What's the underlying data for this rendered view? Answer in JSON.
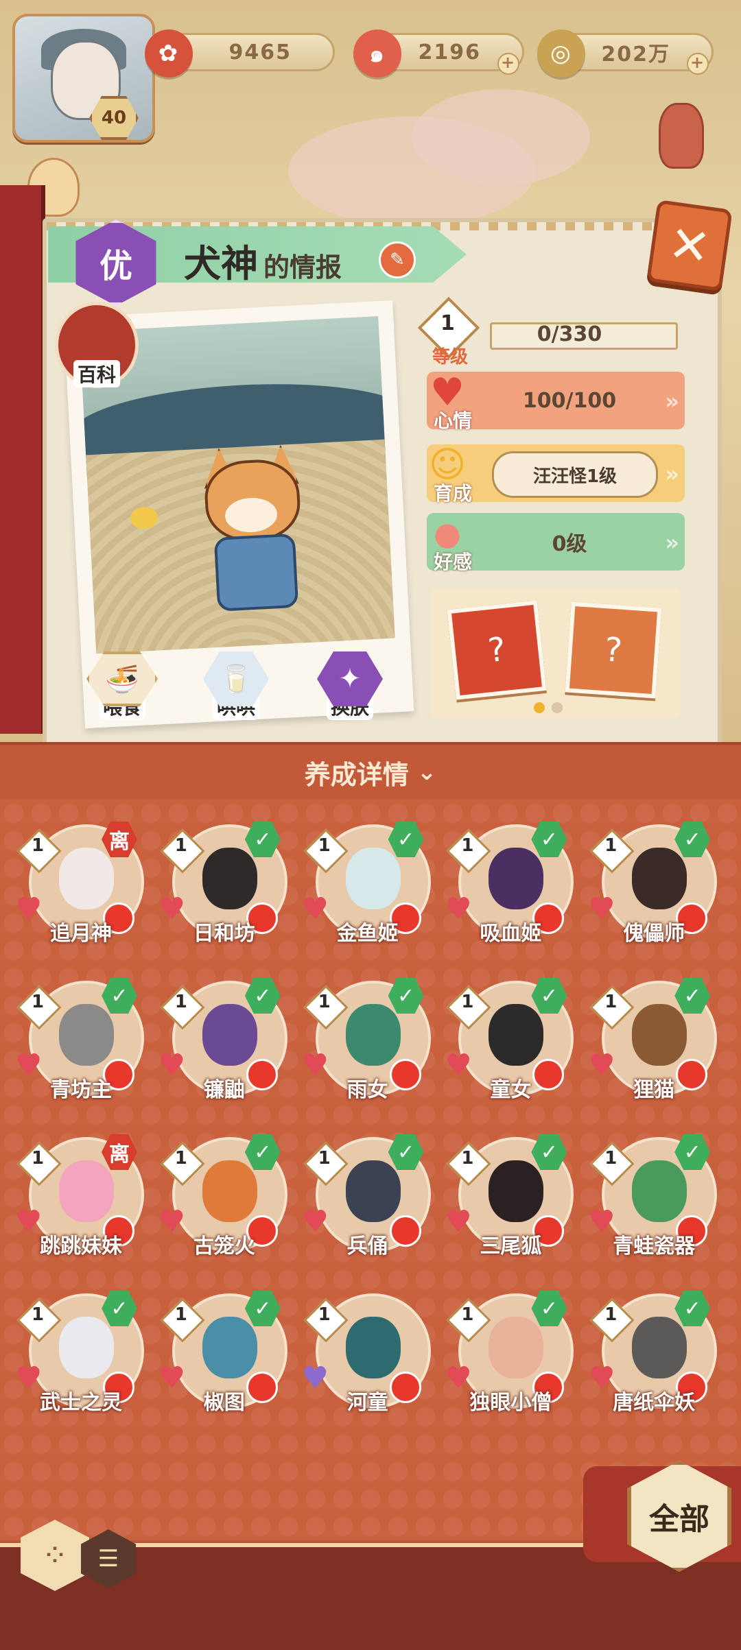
{
  "player": {
    "level": "40"
  },
  "currencies": [
    {
      "icon": "plum-flower-icon",
      "value": "9465",
      "color": "#d6533b"
    },
    {
      "icon": "magatama-icon",
      "value": "2196",
      "color": "#e0604a"
    },
    {
      "icon": "coin-icon",
      "value": "202万",
      "color": "#c9a254"
    }
  ],
  "info": {
    "rank": "优",
    "name": "犬神",
    "title_suffix": "的情报",
    "baike": "百科",
    "actions": [
      {
        "icon": "ramen-bowl-icon",
        "label": "喂食"
      },
      {
        "icon": "milk-carton-icon",
        "label": "哄哄"
      },
      {
        "icon": "clothes-icon",
        "label": "换肤"
      }
    ]
  },
  "stats": {
    "level": {
      "value": "1",
      "label": "等级",
      "progress": "0/330"
    },
    "mood": {
      "label": "心情",
      "value": "100/100"
    },
    "growth": {
      "label": "育成",
      "value": "汪汪怪1级"
    },
    "favor": {
      "label": "好感",
      "value": "0级"
    }
  },
  "carousel": {
    "pages": 2,
    "active": 0
  },
  "detail_header": "养成详情",
  "monsters": [
    {
      "name": "追月神",
      "level": "1",
      "status": "离",
      "heart": "red",
      "color": "#f1e9e6"
    },
    {
      "name": "日和坊",
      "level": "1",
      "status": "✓",
      "heart": "red",
      "color": "#2e2a2a"
    },
    {
      "name": "金鱼姬",
      "level": "1",
      "status": "✓",
      "heart": "red",
      "color": "#d6e8ea"
    },
    {
      "name": "吸血姬",
      "level": "1",
      "status": "✓",
      "heart": "red",
      "color": "#4b2f63"
    },
    {
      "name": "傀儡师",
      "level": "1",
      "status": "✓",
      "heart": "red",
      "color": "#3a2a28"
    },
    {
      "name": "青坊主",
      "level": "1",
      "status": "✓",
      "heart": "red",
      "color": "#8c8a88"
    },
    {
      "name": "镰鼬",
      "level": "1",
      "status": "✓",
      "heart": "red",
      "color": "#6a4b93"
    },
    {
      "name": "雨女",
      "level": "1",
      "status": "✓",
      "heart": "red",
      "color": "#3c8a6e"
    },
    {
      "name": "童女",
      "level": "1",
      "status": "✓",
      "heart": "red",
      "color": "#2d2a2a"
    },
    {
      "name": "狸猫",
      "level": "1",
      "status": "✓",
      "heart": "red",
      "color": "#8a5a34"
    },
    {
      "name": "跳跳妹妹",
      "level": "1",
      "status": "离",
      "heart": "red",
      "color": "#f3a5bd"
    },
    {
      "name": "古笼火",
      "level": "1",
      "status": "✓",
      "heart": "red",
      "color": "#e07a3a"
    },
    {
      "name": "兵俑",
      "level": "1",
      "status": "✓",
      "heart": "red",
      "color": "#3b4252"
    },
    {
      "name": "三尾狐",
      "level": "1",
      "status": "✓",
      "heart": "red",
      "color": "#2a2222"
    },
    {
      "name": "青蛙瓷器",
      "level": "1",
      "status": "✓",
      "heart": "red",
      "color": "#4a9a5c"
    },
    {
      "name": "武士之灵",
      "level": "1",
      "status": "✓",
      "heart": "red",
      "color": "#e9e9ee"
    },
    {
      "name": "椒图",
      "level": "1",
      "status": "✓",
      "heart": "red",
      "color": "#4a8ea8"
    },
    {
      "name": "河童",
      "level": "1",
      "status": "",
      "heart": "purple",
      "color": "#2d6b6e"
    },
    {
      "name": "独眼小僧",
      "level": "1",
      "status": "✓",
      "heart": "red",
      "color": "#e9b39a"
    },
    {
      "name": "唐纸伞妖",
      "level": "1",
      "status": "✓",
      "heart": "red",
      "color": "#5c5a58"
    }
  ],
  "all_button": "全部",
  "view_toggle": {
    "grid_icon": "grid-view-icon",
    "list_icon": "list-view-icon"
  }
}
